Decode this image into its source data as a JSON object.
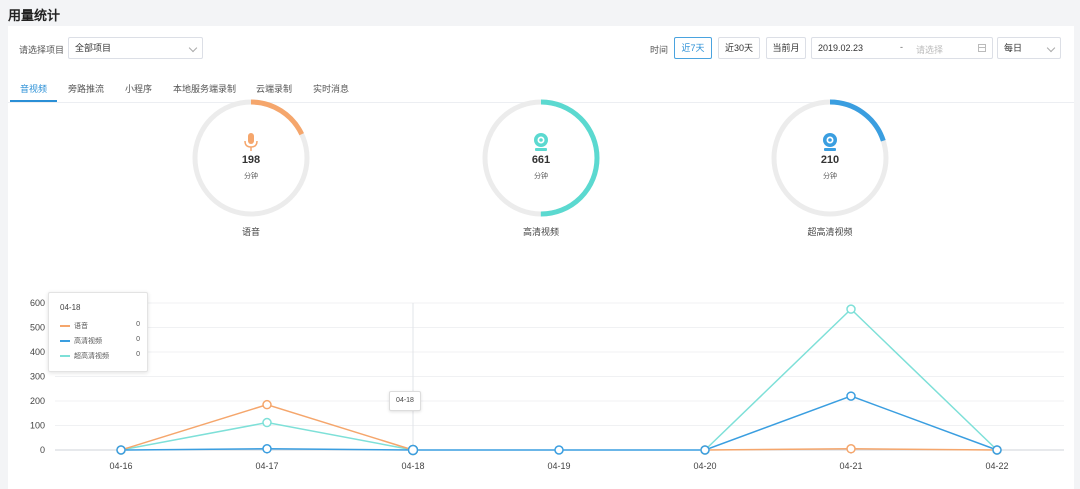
{
  "page": {
    "title": "用量统计"
  },
  "filters": {
    "project_label": "请选择项目",
    "project_value": "全部项目",
    "time_label": "时间",
    "range_buttons": [
      {
        "label": "近7天",
        "active": true
      },
      {
        "label": "近30天",
        "active": false
      },
      {
        "label": "当前月",
        "active": false
      }
    ],
    "date_start": "2019.02.23",
    "date_separator": "-",
    "date_end_placeholder": "请选择",
    "granularity": "每日"
  },
  "tabs": [
    {
      "label": "音视频",
      "active": true
    },
    {
      "label": "旁路推流",
      "active": false
    },
    {
      "label": "小程序",
      "active": false
    },
    {
      "label": "本地服务端录制",
      "active": false
    },
    {
      "label": "云端录制",
      "active": false
    },
    {
      "label": "实时消息",
      "active": false
    }
  ],
  "gauges": [
    {
      "name": "语音",
      "value": "198",
      "unit": "分钟",
      "fraction": 0.18,
      "color": "#f5a66c",
      "icon": "microphone-icon"
    },
    {
      "name": "高清视频",
      "value": "661",
      "unit": "分钟",
      "fraction": 0.5,
      "color": "#5bd9d0",
      "icon": "webcam-icon"
    },
    {
      "name": "超高清视频",
      "value": "210",
      "unit": "分钟",
      "fraction": 0.2,
      "color": "#3a9ee0",
      "icon": "webcam-icon"
    }
  ],
  "tooltip": {
    "title": "04-18",
    "rows": [
      {
        "name": "语音",
        "value": "0",
        "color": "#f5a66c"
      },
      {
        "name": "高清视频",
        "value": "0",
        "color": "#3a9ee0"
      },
      {
        "name": "超高清视频",
        "value": "0",
        "color": "#7ee0d8"
      }
    ]
  },
  "pin_label": "04-18",
  "chart_data": {
    "type": "line",
    "x": [
      "04-16",
      "04-17",
      "04-18",
      "04-19",
      "04-20",
      "04-21",
      "04-22"
    ],
    "ylim": [
      0,
      600
    ],
    "yticks": [
      0,
      100,
      200,
      300,
      400,
      500,
      600
    ],
    "grid": true,
    "highlight_index": 2,
    "series": [
      {
        "name": "语音",
        "color": "#f5a66c",
        "values": [
          0,
          185,
          0,
          null,
          0,
          5,
          0
        ]
      },
      {
        "name": "高清视频",
        "color": "#3a9ee0",
        "values": [
          0,
          5,
          0,
          0,
          0,
          220,
          0
        ]
      },
      {
        "name": "超高清视频",
        "color": "#7ee0d8",
        "values": [
          0,
          112,
          0,
          null,
          0,
          575,
          0
        ]
      }
    ]
  }
}
